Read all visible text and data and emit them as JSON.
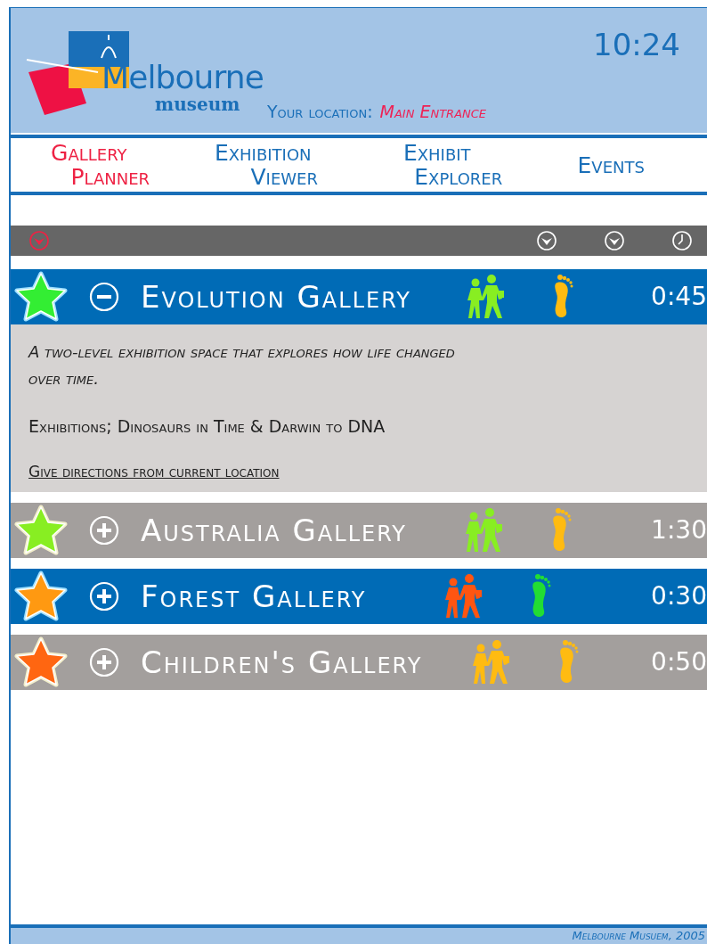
{
  "header": {
    "logo_name": "Melbourne",
    "logo_sub": "museum",
    "location_label": "Your location:",
    "location": "Main Entrance",
    "time": "10:24"
  },
  "tabs": [
    {
      "lines": [
        "Gallery",
        "Planner"
      ],
      "selected": true
    },
    {
      "lines": [
        "Exhibition",
        "Viewer"
      ],
      "selected": false
    },
    {
      "lines": [
        "Exhibit",
        "Explorer"
      ],
      "selected": false
    },
    {
      "lines": [
        "Events"
      ],
      "selected": false
    }
  ],
  "sort_bar": [
    {
      "kind": "sort",
      "selected": true
    },
    {
      "kind": "sort",
      "selected": false
    },
    {
      "kind": "sort",
      "selected": false
    },
    {
      "kind": "time",
      "selected": false
    }
  ],
  "galleries": [
    {
      "name": "Evolution Gallery",
      "expanded": true,
      "color": "#006bb6",
      "star": {
        "color": "#33ee33"
      },
      "group": {
        "color": "#88ee22"
      },
      "foot": {
        "color": "#ffbb11"
      },
      "time": "0:45",
      "description": "A two-level exhibition space that explores how life changed over time.",
      "exhibitions": "Exhibitions; Dinosaurs in Time & Darwin to DNA",
      "link": "Give directions from current location"
    },
    {
      "name": "Australia Gallery",
      "expanded": false,
      "color": "#a39f9d",
      "star": {
        "color": "#88ee22"
      },
      "group": {
        "color": "#88ee22"
      },
      "foot": {
        "color": "#ffbb11"
      },
      "time": "1:30"
    },
    {
      "name": "Forest Gallery",
      "expanded": false,
      "color": "#006bb6",
      "star": {
        "color": "#ff9911"
      },
      "group": {
        "color": "#ff5511"
      },
      "foot": {
        "color": "#22dd33"
      },
      "time": "0:30"
    },
    {
      "name": "Children's Gallery",
      "expanded": false,
      "color": "#a39f9d",
      "star": {
        "color": "#ff6611"
      },
      "group": {
        "color": "#ffbb11"
      },
      "foot": {
        "color": "#ffbb11"
      },
      "time": "0:50"
    }
  ],
  "footer": "Melbourne Musuem, 2005"
}
